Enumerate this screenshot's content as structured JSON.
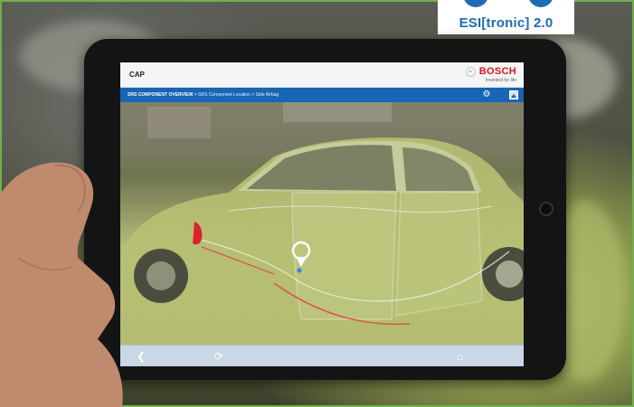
{
  "badge": {
    "label": "ESI[tronic] 2.0"
  },
  "app": {
    "title": "CAP",
    "brand": "BOSCH",
    "brand_tagline": "Invented for life",
    "breadcrumb": {
      "root": "SRS COMPONENT OVERVIEW",
      "rest": " > SRS Component Location > Side Airbag"
    }
  },
  "icons": {
    "settings": "gear-icon",
    "image": "image-icon",
    "back": "chevron-left-icon",
    "reload": "refresh-icon",
    "home": "home-icon"
  },
  "colors": {
    "brand_red": "#e2141b",
    "nav_blue": "#1865b4",
    "badge_blue": "#1f6cb4",
    "border_green": "#6fb14c"
  }
}
